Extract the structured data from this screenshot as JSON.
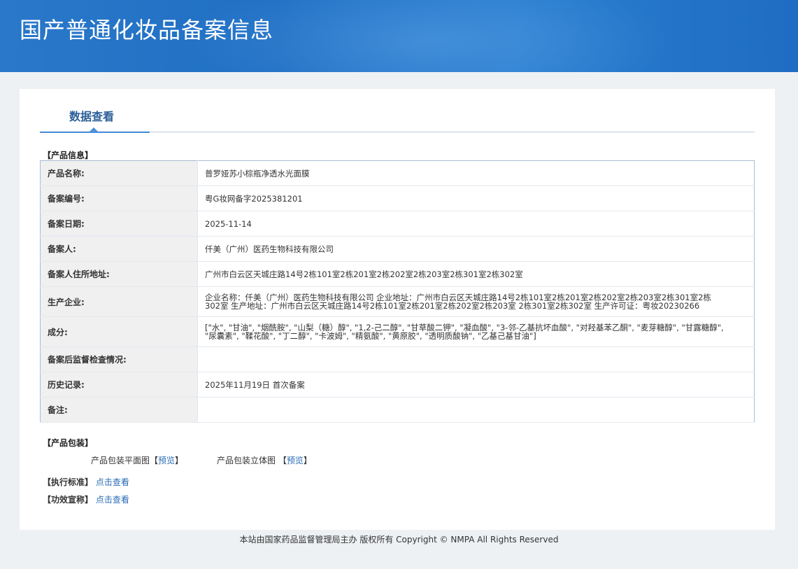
{
  "header": {
    "title": "国产普通化妆品备案信息"
  },
  "tabs": [
    {
      "label": "数据查看"
    }
  ],
  "product_info": {
    "section_label": "【产品信息】",
    "rows": [
      {
        "label": "产品名称:",
        "value": "普罗娅苏小棕瓶净透水光面膜"
      },
      {
        "label": "备案编号:",
        "value": "粤G妆网备字2025381201"
      },
      {
        "label": "备案日期:",
        "value": "2025-11-14"
      },
      {
        "label": "备案人:",
        "value": "仟美（广州）医药生物科技有限公司"
      },
      {
        "label": "备案人住所地址:",
        "value": "广州市白云区天城庄路14号2栋101室2栋201室2栋202室2栋203室2栋301室2栋302室"
      },
      {
        "label": "生产企业:",
        "value": "企业名称：仟美（广州）医药生物科技有限公司 企业地址：广州市白云区天城庄路14号2栋101室2栋201室2栋202室2栋203室2栋301室2栋302室 生产地址：广州市白云区天城庄路14号2栋101室2栋201室2栋202室2栋203室 2栋301室2栋302室 生产许可证：粤妆20230266"
      },
      {
        "label": "成分:",
        "value": "[\"水\", \"甘油\", \"烟酰胺\", \"山梨（糖）醇\", \"1,2-己二醇\", \"甘草酸二钾\", \"凝血酸\", \"3-邻-乙基抗坏血酸\", \"对羟基苯乙酮\", \"麦芽糖醇\", \"甘露糖醇\", \"尿囊素\", \"鞣花酸\", \"丁二醇\", \"卡波姆\", \"精氨酸\", \"黄原胶\", \"透明质酸钠\", \"乙基己基甘油\"]"
      },
      {
        "label": "备案后监督检查情况:",
        "value": ""
      },
      {
        "label": "历史记录:",
        "value": "2025年11月19日 首次备案"
      },
      {
        "label": "备注:",
        "value": ""
      }
    ]
  },
  "packaging": {
    "section_label": "【产品包装】",
    "flat_label": "产品包装平面图",
    "solid_label": "产品包装立体图",
    "preview_text": "预览",
    "bracket_open": "【",
    "bracket_close": "】"
  },
  "standard": {
    "label": "【执行标准】",
    "link": "点击查看"
  },
  "efficacy": {
    "label": "【功效宣称】",
    "link": "点击查看"
  },
  "footer": {
    "text": "本站由国家药品监督管理局主办 版权所有 Copyright © NMPA All Rights Reserved"
  }
}
